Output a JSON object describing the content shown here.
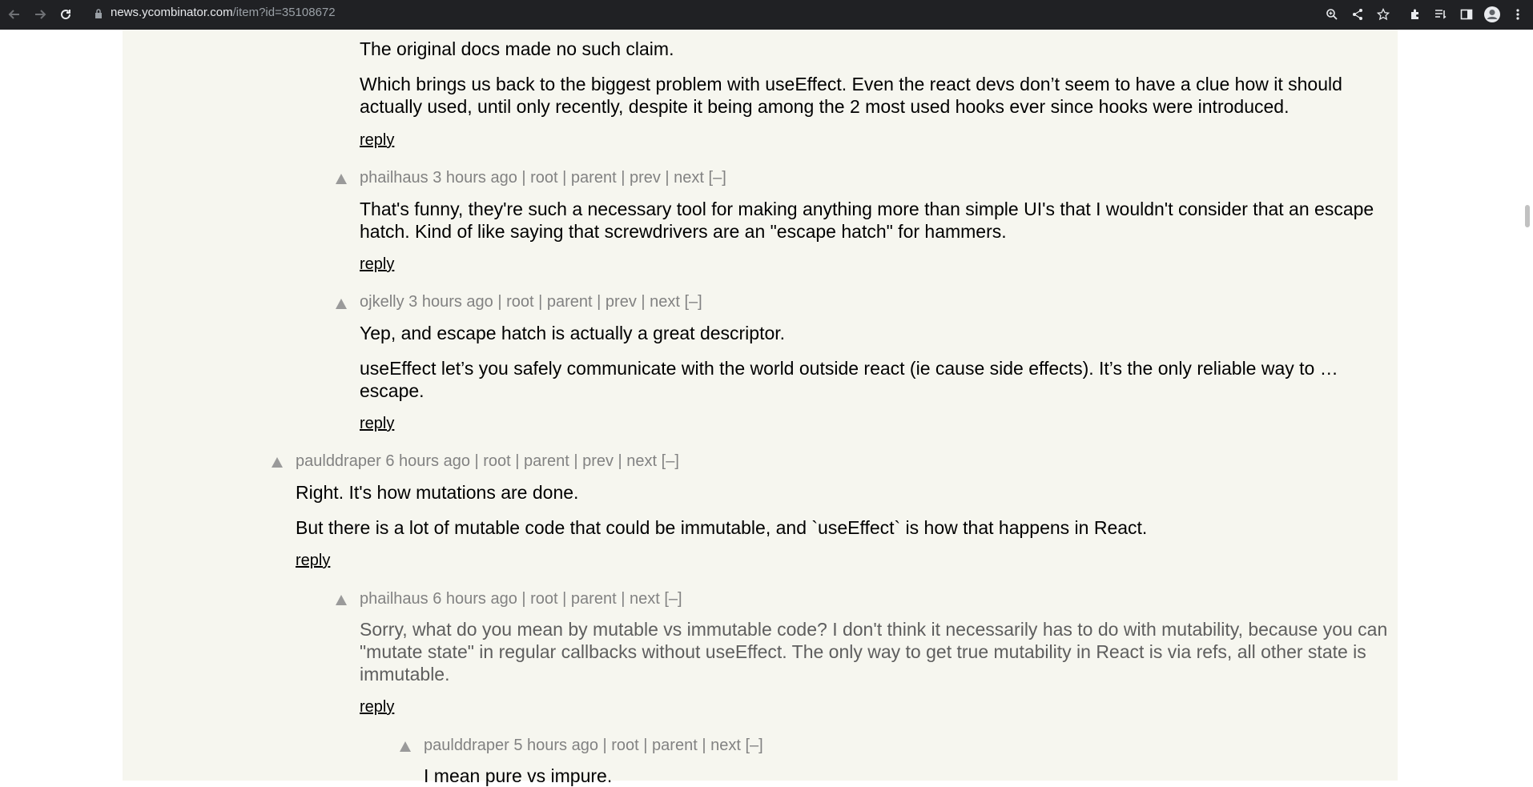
{
  "browser": {
    "url_host": "news.ycombinator.com",
    "url_path": "/item?id=35108672"
  },
  "comments": [
    {
      "paragraphs": [
        "The original docs made no such claim.",
        "Which brings us back to the biggest problem with useEffect. Even the react devs don’t seem to have a clue how it should actually used, until only recently, despite it being among the 2 most used hooks ever since hooks were introduced."
      ],
      "reply": "reply"
    },
    {
      "user": "phailhaus",
      "age": "3 hours ago",
      "links": [
        "root",
        "parent",
        "prev",
        "next"
      ],
      "toggle": "[–]",
      "paragraphs": [
        "That's funny, they're such a necessary tool for making anything more than simple UI's that I wouldn't consider that an escape hatch. Kind of like saying that screwdrivers are an \"escape hatch\" for hammers."
      ],
      "reply": "reply"
    },
    {
      "user": "ojkelly",
      "age": "3 hours ago",
      "links": [
        "root",
        "parent",
        "prev",
        "next"
      ],
      "toggle": "[–]",
      "paragraphs": [
        "Yep, and escape hatch is actually a great descriptor.",
        "useEffect let’s you safely communicate with the world outside react (ie cause side effects). It’s the only reliable way to … escape."
      ],
      "reply": "reply"
    },
    {
      "user": "paulddraper",
      "age": "6 hours ago",
      "links": [
        "root",
        "parent",
        "prev",
        "next"
      ],
      "toggle": "[–]",
      "paragraphs": [
        "Right. It's how mutations are done.",
        "But there is a lot of mutable code that could be immutable, and `useEffect` is how that happens in React."
      ],
      "reply": "reply"
    },
    {
      "user": "phailhaus",
      "age": "6 hours ago",
      "links": [
        "root",
        "parent",
        "next"
      ],
      "toggle": "[–]",
      "paragraphs": [
        "Sorry, what do you mean by mutable vs immutable code? I don't think it necessarily has to do with mutability, because you can \"mutate state\" in regular callbacks without useEffect. The only way to get true mutability in React is via refs, all other state is immutable."
      ],
      "reply": "reply"
    },
    {
      "user": "paulddraper",
      "age": "5 hours ago",
      "links": [
        "root",
        "parent",
        "next"
      ],
      "toggle": "[–]",
      "paragraphs": [
        "I mean pure vs impure."
      ]
    }
  ]
}
